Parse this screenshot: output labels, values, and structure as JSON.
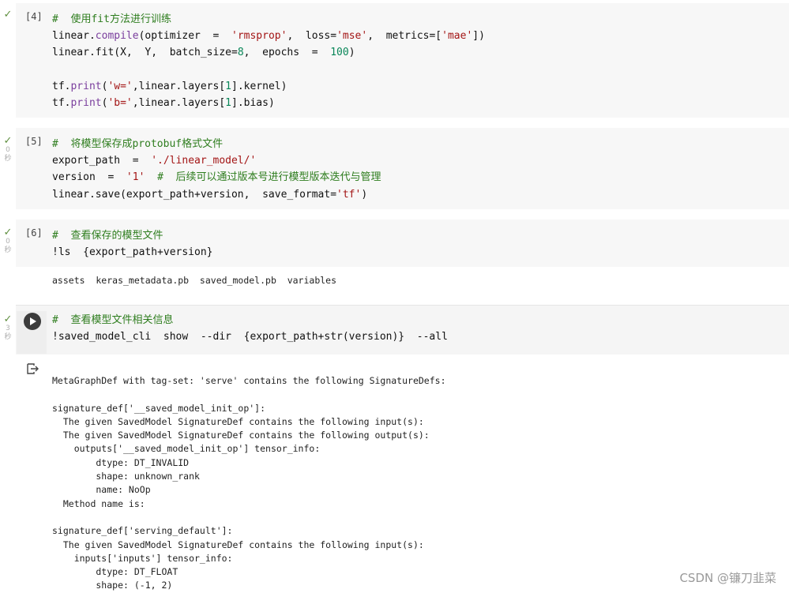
{
  "cells": [
    {
      "exec_count": "[4]",
      "lines": [
        [
          {
            "t": "cm",
            "v": "#  使用fit方法进行训练"
          }
        ],
        [
          {
            "t": "",
            "v": "linear."
          },
          {
            "t": "kw",
            "v": "compile"
          },
          {
            "t": "",
            "v": "(optimizer  =  "
          },
          {
            "t": "st",
            "v": "'rmsprop'"
          },
          {
            "t": "",
            "v": ",  loss="
          },
          {
            "t": "st",
            "v": "'mse'"
          },
          {
            "t": "",
            "v": ",  metrics=["
          },
          {
            "t": "st",
            "v": "'mae'"
          },
          {
            "t": "",
            "v": "])"
          }
        ],
        [
          {
            "t": "",
            "v": "linear.fit(X,  Y,  batch_size="
          },
          {
            "t": "num",
            "v": "8"
          },
          {
            "t": "",
            "v": ",  epochs  =  "
          },
          {
            "t": "num",
            "v": "100"
          },
          {
            "t": "",
            "v": ")"
          }
        ],
        [
          {
            "t": "",
            "v": ""
          }
        ],
        [
          {
            "t": "",
            "v": "tf."
          },
          {
            "t": "kw",
            "v": "print"
          },
          {
            "t": "",
            "v": "("
          },
          {
            "t": "st",
            "v": "'w='"
          },
          {
            "t": "",
            "v": ",linear.layers["
          },
          {
            "t": "num",
            "v": "1"
          },
          {
            "t": "",
            "v": "].kernel)"
          }
        ],
        [
          {
            "t": "",
            "v": "tf."
          },
          {
            "t": "kw",
            "v": "print"
          },
          {
            "t": "",
            "v": "("
          },
          {
            "t": "st",
            "v": "'b='"
          },
          {
            "t": "",
            "v": ",linear.layers["
          },
          {
            "t": "num",
            "v": "1"
          },
          {
            "t": "",
            "v": "].bias)"
          }
        ]
      ]
    },
    {
      "exec_count": "[5]",
      "time": [
        "0",
        "秒"
      ],
      "lines": [
        [
          {
            "t": "cm",
            "v": "#  将模型保存成protobuf格式文件"
          }
        ],
        [
          {
            "t": "",
            "v": "export_path  =  "
          },
          {
            "t": "st",
            "v": "'./linear_model/'"
          }
        ],
        [
          {
            "t": "",
            "v": "version  =  "
          },
          {
            "t": "st",
            "v": "'1'"
          },
          {
            "t": "",
            "v": "  "
          },
          {
            "t": "cm",
            "v": "#  后续可以通过版本号进行模型版本迭代与管理"
          }
        ],
        [
          {
            "t": "",
            "v": "linear.save(export_path+version,  save_format="
          },
          {
            "t": "st",
            "v": "'tf'"
          },
          {
            "t": "",
            "v": ")"
          }
        ]
      ]
    },
    {
      "exec_count": "[6]",
      "time": [
        "0",
        "秒"
      ],
      "lines": [
        [
          {
            "t": "cm",
            "v": "#  查看保存的模型文件"
          }
        ],
        [
          {
            "t": "",
            "v": "!ls  {export_path+version}"
          }
        ]
      ],
      "output": "assets  keras_metadata.pb  saved_model.pb  variables"
    },
    {
      "time": [
        "3",
        "秒"
      ],
      "lines": [
        [
          {
            "t": "cm",
            "v": "#  查看模型文件相关信息"
          }
        ],
        [
          {
            "t": "",
            "v": "!saved_model_cli  show  --dir  {export_path+str(version)}  --all"
          }
        ]
      ],
      "output_lines": [
        "MetaGraphDef with tag-set: 'serve' contains the following SignatureDefs:",
        "",
        "signature_def['__saved_model_init_op']:",
        "  The given SavedModel SignatureDef contains the following input(s):",
        "  The given SavedModel SignatureDef contains the following output(s):",
        "    outputs['__saved_model_init_op'] tensor_info:",
        "        dtype: DT_INVALID",
        "        shape: unknown_rank",
        "        name: NoOp",
        "  Method name is:",
        "",
        "signature_def['serving_default']:",
        "  The given SavedModel SignatureDef contains the following input(s):",
        "    inputs['inputs'] tensor_info:",
        "        dtype: DT_FLOAT",
        "        shape: (-1, 2)"
      ]
    }
  ],
  "checkmark": "✓",
  "watermark": "CSDN @镰刀韭菜"
}
